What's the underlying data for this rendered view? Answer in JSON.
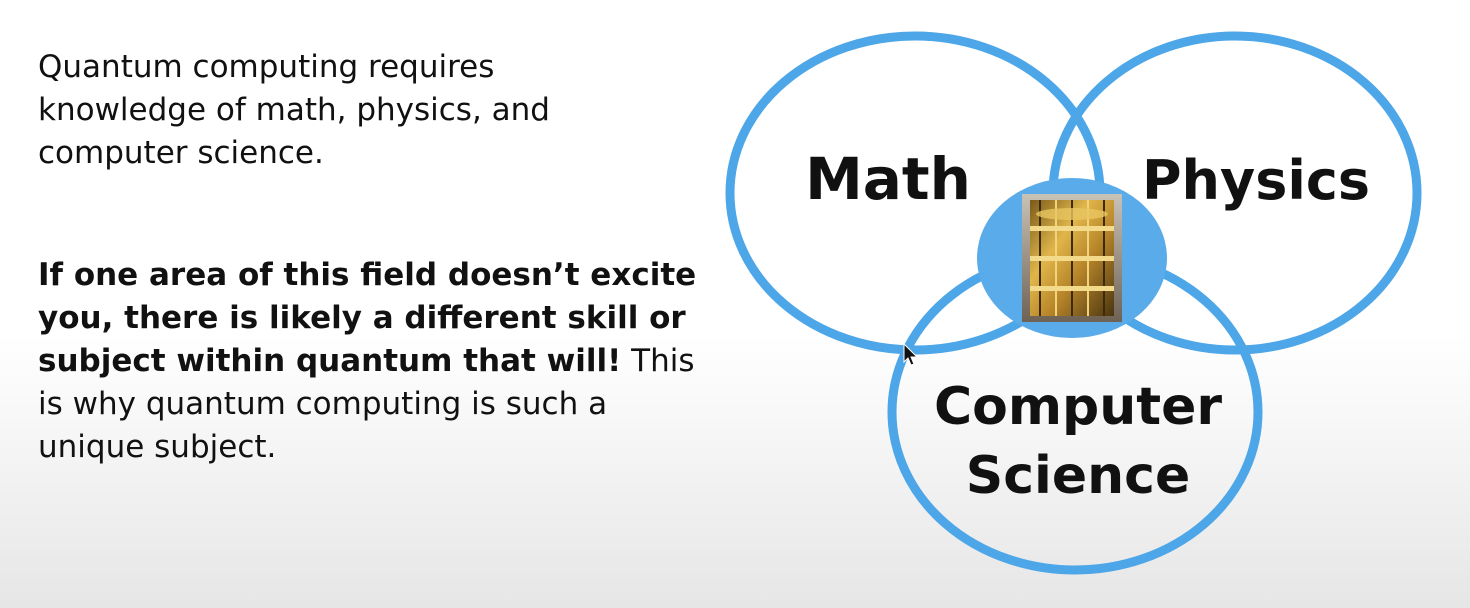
{
  "slide": {
    "intro_text": "Quantum computing requires knowledge of math, physics, and computer science.",
    "emphasis_text": "If one area of this field doesn’t excite you, there is likely a different skill or subject within quantum that will!",
    "follow_text": "This is why quantum computing is such a unique subject."
  },
  "venn": {
    "circle_color": "#4da6e8",
    "center_fill": "#5aabea",
    "labels": {
      "math": "Math",
      "physics": "Physics",
      "cs_line1": "Computer",
      "cs_line2": "Science"
    },
    "center_image": "quantum-computer-chandelier-photo"
  },
  "cursor": "mouse-pointer-icon"
}
